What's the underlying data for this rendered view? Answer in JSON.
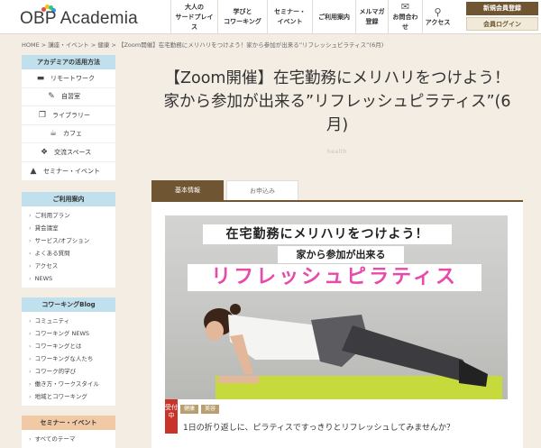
{
  "header": {
    "logo_text": "OBP Academia",
    "logo_colors": [
      "#e74c3c",
      "#f1c40f",
      "#2ecc71",
      "#3498db"
    ],
    "nav": [
      {
        "line1": "大人の",
        "line2": "サードプレイス"
      },
      {
        "line1": "学びと",
        "line2": "コワーキング"
      },
      {
        "line1": "セミナー・",
        "line2": "イベント"
      },
      {
        "line1": "ご利用案内",
        "line2": ""
      },
      {
        "line1": "メルマガ",
        "line2": "登録"
      },
      {
        "icon": "✉",
        "line1": "お問合わせ"
      },
      {
        "icon": "⚲",
        "line1": "アクセス"
      }
    ],
    "register_label": "新規会員登録",
    "login_label": "会員ログイン"
  },
  "breadcrumb": "HOME  >  講座・イベント  >  健康  >  【Zoom開催】在宅勤務にメリハリをつけよう！家から参加が出来る”リフレッシュピラティス”(6月)",
  "sidebar": {
    "usage": {
      "title": "アカデミアの活用方法",
      "items": [
        {
          "icon": "folder",
          "label": "リモートワーク"
        },
        {
          "icon": "pen",
          "label": "自習室"
        },
        {
          "icon": "book",
          "label": "ライブラリー"
        },
        {
          "icon": "cup",
          "label": "カフェ"
        },
        {
          "icon": "chat",
          "label": "交流スペース"
        },
        {
          "icon": "cap",
          "label": "セミナー・イベント"
        }
      ]
    },
    "guide": {
      "title": "ご利用案内",
      "items": [
        "ご利用プラン",
        "貸会議室",
        "サービス/オプション",
        "よくある質問",
        "アクセス",
        "NEWS"
      ]
    },
    "blog": {
      "title": "コワーキングBlog",
      "items": [
        "コミュニティ",
        "コワーキング NEWS",
        "コワーキングとは",
        "コワーキングな人たち",
        "コワーク的学び",
        "働き方・ワークスタイル",
        "地域とコワーキング"
      ]
    },
    "seminar": {
      "title": "セミナー・イベント",
      "items": [
        "すべてのテーマ"
      ]
    }
  },
  "main": {
    "title_line1": "【Zoom開催】在宅勤務にメリハリをつけよう！",
    "title_line2": "家から参加が出来る”リフレッシュピラティス”(6",
    "title_line3": "月)",
    "sub_label": "health",
    "tabs": [
      "基本情報",
      "お申込み"
    ],
    "hero": {
      "line1": "在宅勤務にメリハリをつけよう！",
      "line2": "家から参加が出来る",
      "line3": "リフレッシュピラティス"
    },
    "badge": "受付中",
    "tags": [
      "健康",
      "美容"
    ],
    "description": "1日の折り返しに、ピラティスですっきりとリフレッシュしてみませんか？"
  }
}
